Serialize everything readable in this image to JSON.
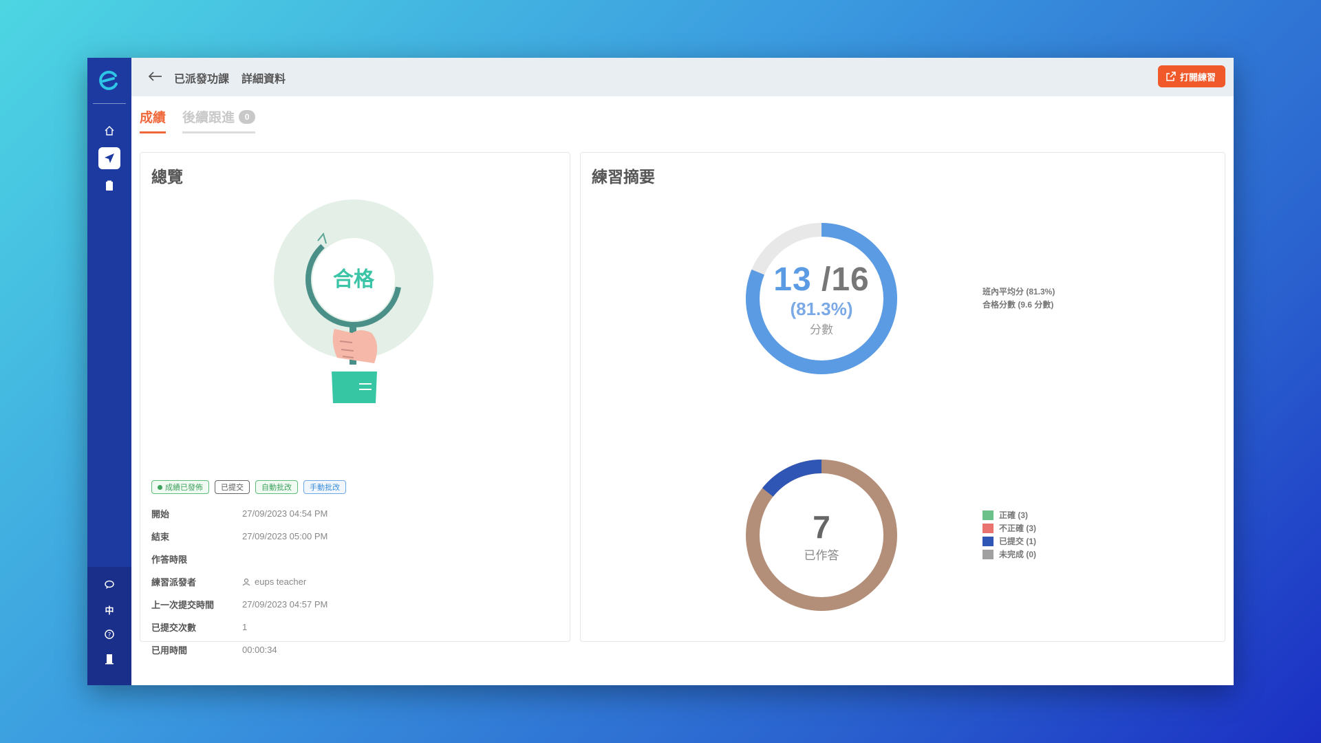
{
  "topbar": {
    "crumb_section": "已派發功課",
    "crumb_page": "詳細資料",
    "open_button": "打開練習"
  },
  "tabs": [
    {
      "label": "成績"
    },
    {
      "label": "後續跟進",
      "badge": "0"
    }
  ],
  "overview": {
    "title": "總覽",
    "stamp_text": "合格",
    "tags": [
      "成績已發佈",
      "已提交",
      "自動批改",
      "手動批改"
    ],
    "rows": [
      {
        "key": "開始",
        "value": "27/09/2023 04:54 PM"
      },
      {
        "key": "結束",
        "value": "27/09/2023 05:00 PM"
      },
      {
        "key": "作答時限",
        "value": ""
      },
      {
        "key": "練習派發者",
        "value": "eups teacher"
      },
      {
        "key": "上一次提交時間",
        "value": "27/09/2023 04:57 PM"
      },
      {
        "key": "已提交次數",
        "value": "1"
      },
      {
        "key": "已用時間",
        "value": "00:00:34"
      }
    ]
  },
  "summary": {
    "title": "練習摘要",
    "score": {
      "obtained": "13",
      "total": "/16",
      "percent": "(81.3%)",
      "unit": "分數",
      "fraction": 0.8125,
      "legend_avg": "班內平均分 (81.3%)",
      "legend_pass": "合格分數 (9.6 分數)",
      "colors": {
        "score": "#5b9be3",
        "remaining": "#e8e8e8"
      }
    },
    "answers": {
      "count": "7",
      "label": "已作答",
      "legend": [
        {
          "label": "正確 (3)",
          "color": "#6cc08a",
          "value": 3
        },
        {
          "label": "不正確 (3)",
          "color": "#e8736f",
          "value": 3
        },
        {
          "label": "已提交 (1)",
          "color": "#2f56b4",
          "value": 1
        },
        {
          "label": "未完成 (0)",
          "color": "#a0a0a0",
          "value": 0
        }
      ],
      "ring_color": "#b38f79"
    }
  }
}
